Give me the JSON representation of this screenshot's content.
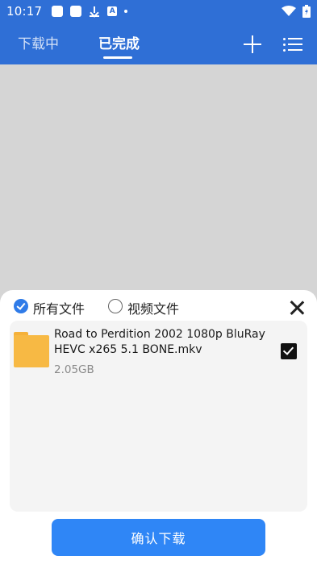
{
  "status_bar": {
    "time": "10:17",
    "icons": [
      "app-icon",
      "app-icon",
      "download-icon",
      "a-icon",
      "dot-icon",
      "wifi-icon",
      "battery-icon"
    ]
  },
  "header": {
    "tabs": [
      {
        "label": "下载中",
        "active": false
      },
      {
        "label": "已完成",
        "active": true
      }
    ],
    "actions": [
      "add-icon",
      "list-menu-icon"
    ]
  },
  "sheet": {
    "filters": [
      {
        "label": "所有文件",
        "selected": true
      },
      {
        "label": "视频文件",
        "selected": false
      }
    ],
    "files": [
      {
        "name": "Road to Perdition 2002 1080p BluRay HEVC x265 5.1 BONE.mkv",
        "size": "2.05GB",
        "checked": true
      }
    ],
    "confirm_label": "确认下载"
  },
  "colors": {
    "header_blue": "#2f6fd6",
    "button_blue": "#2f86f6",
    "folder_yellow": "#f7b944"
  }
}
